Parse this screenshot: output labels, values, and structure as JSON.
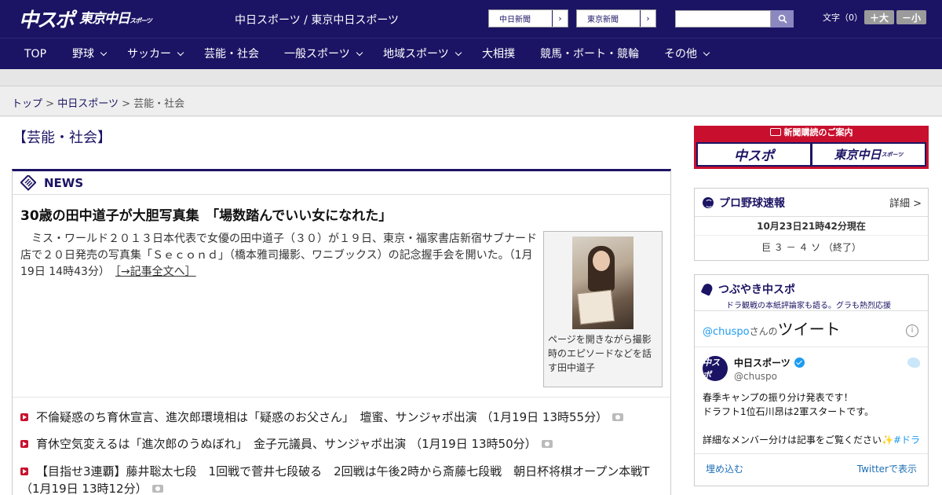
{
  "header": {
    "logo_main": "中スポ",
    "logo_sub": "東京中日",
    "logo_sub_small": "スポーツ",
    "site_names": "中日スポーツ / 東京中日スポーツ",
    "paper_links": [
      {
        "label": "中日新聞"
      },
      {
        "label": "東京新聞"
      }
    ],
    "search_placeholder": "",
    "fontsize_label": "文字（0）",
    "fontsize_up": "＋大",
    "fontsize_down": "－小"
  },
  "nav": {
    "items": [
      {
        "label": "TOP"
      },
      {
        "label": "野球"
      },
      {
        "label": "サッカー"
      },
      {
        "label": "芸能・社会"
      },
      {
        "label": "一般スポーツ"
      },
      {
        "label": "地域スポーツ"
      },
      {
        "label": "大相撲"
      },
      {
        "label": "競馬・ボート・競輪"
      },
      {
        "label": "その他"
      }
    ]
  },
  "breadcrumb": {
    "home": "トップ",
    "section": "中日スポーツ",
    "current": "芸能・社会",
    "sep": ">"
  },
  "category_title": "【芸能・社会】",
  "news": {
    "label": "NEWS",
    "lead": {
      "title": "30歳の田中道子が大胆写真集　「場数踏んでいい女になれた」",
      "body": "　ミス・ワールド２０１３日本代表で女優の田中道子（３０）が１９日、東京・福家書店新宿サブナード店で２０日発売の写真集「Ｓｅｃｏｎｄ」（橋本雅司撮影、ワニブックス）の記念握手会を開いた。（1月19日 14時43分）",
      "more": "［→記事全文へ］",
      "photo_caption": "ページを開きながら撮影時のエピソードなどを話す田中道子"
    },
    "headlines": [
      {
        "text": "不倫疑惑のち育休宣言、進次郎環境相は「疑惑のお父さん」　壇蜜、サンジャポ出演 （1月19日 13時55分）"
      },
      {
        "text": "育休空気変えるは「進次郎のうぬぼれ」　金子元議員、サンジャポ出演 （1月19日 13時50分）"
      },
      {
        "text": "【目指せ3連覇】藤井聡太七段　1回戦で菅井七段破る　2回戦は午後2時から斎藤七段戦　朝日杯将棋オープン本戦T （1月19日 13時12分）"
      }
    ]
  },
  "subscription": {
    "title": "新聞購読のご案内",
    "logo1": "中スポ",
    "logo2": "東京中日",
    "logo2_small": "スポーツ"
  },
  "baseball": {
    "title": "プロ野球速報",
    "detail": "詳細 >",
    "time": "10月23日21時42分現在",
    "game": "巨 ３ － ４ ソ （終了）"
  },
  "twitter": {
    "title": "つぶやき中スポ",
    "subtitle": "ドラ観戦の本紙評論家も語る。グラも熱烈応援",
    "widget_handle": "@chuspo",
    "widget_san": "さんの",
    "widget_tweets": "ツイート",
    "account_name": "中日スポーツ",
    "account_handle": "@chuspo",
    "avatar_text": "中スポ",
    "tweet_text": "春季キャンプの振り分け発表です！\nドラフト1位石川昂は2軍スタートです。\n\n詳細なメンバー分けは記事をご覧ください",
    "tweet_tail": "✨#ドラ",
    "embed": "埋め込む",
    "view_on": "Twitterで表示"
  },
  "colors": {
    "brand": "#1b1464",
    "accent": "#c8102e",
    "twitter": "#1d9bf0"
  }
}
